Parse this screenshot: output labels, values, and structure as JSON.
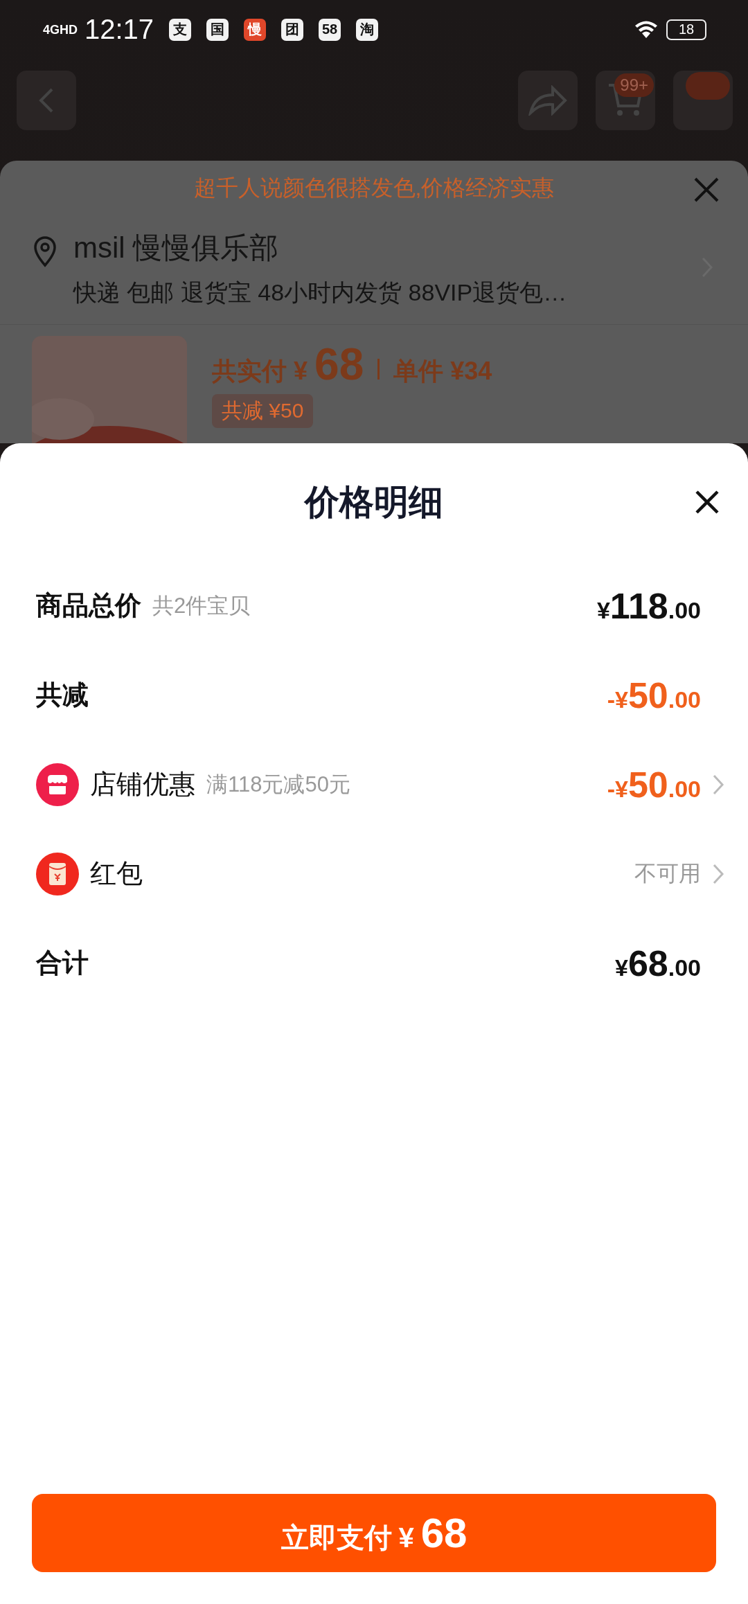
{
  "status_bar": {
    "network": "4GHD",
    "time": "12:17",
    "app_icons": [
      {
        "label": "支",
        "kind": "plain"
      },
      {
        "label": "国",
        "kind": "plain"
      },
      {
        "label": "慢",
        "kind": "accent"
      },
      {
        "label": "团",
        "kind": "plain"
      },
      {
        "label": "58",
        "kind": "plain"
      },
      {
        "label": "淘",
        "kind": "plain"
      }
    ],
    "battery": "18"
  },
  "header": {
    "cart_badge": "99+"
  },
  "order_panel": {
    "banner": "超千人说颜色很搭发色,价格经济实惠",
    "address": {
      "name": "msil 慢慢俱乐部",
      "details": "快递 包邮 退货宝 48小时内发货 88VIP退货包…"
    },
    "product": {
      "paid_label": "共实付",
      "paid_currency": "¥",
      "paid_amount": "68",
      "unit_price": "单件 ¥34",
      "discount_tag": "共减 ¥50"
    }
  },
  "price_sheet": {
    "title": "价格明细",
    "rows": [
      {
        "kind": "total",
        "label": "商品总价",
        "note": "共2件宝贝",
        "amount": {
          "currency": "¥",
          "integer": "118",
          "decimal": ".00",
          "highlight": false
        }
      },
      {
        "kind": "total",
        "label": "共减",
        "amount": {
          "sign": "-",
          "currency": "¥",
          "integer": "50",
          "decimal": ".00",
          "highlight": true
        }
      },
      {
        "kind": "shop",
        "label": "店铺优惠",
        "note": "满118元减50元",
        "amount": {
          "sign": "-",
          "currency": "¥",
          "integer": "50",
          "decimal": ".00",
          "highlight": true
        }
      },
      {
        "kind": "envelope",
        "label": "红包",
        "status": "不可用"
      },
      {
        "kind": "total",
        "label": "合计",
        "amount": {
          "currency": "¥",
          "integer": "68",
          "decimal": ".00",
          "highlight": false
        }
      }
    ],
    "pay_button": {
      "label": "立即支付",
      "currency": "¥",
      "amount": "68"
    }
  }
}
